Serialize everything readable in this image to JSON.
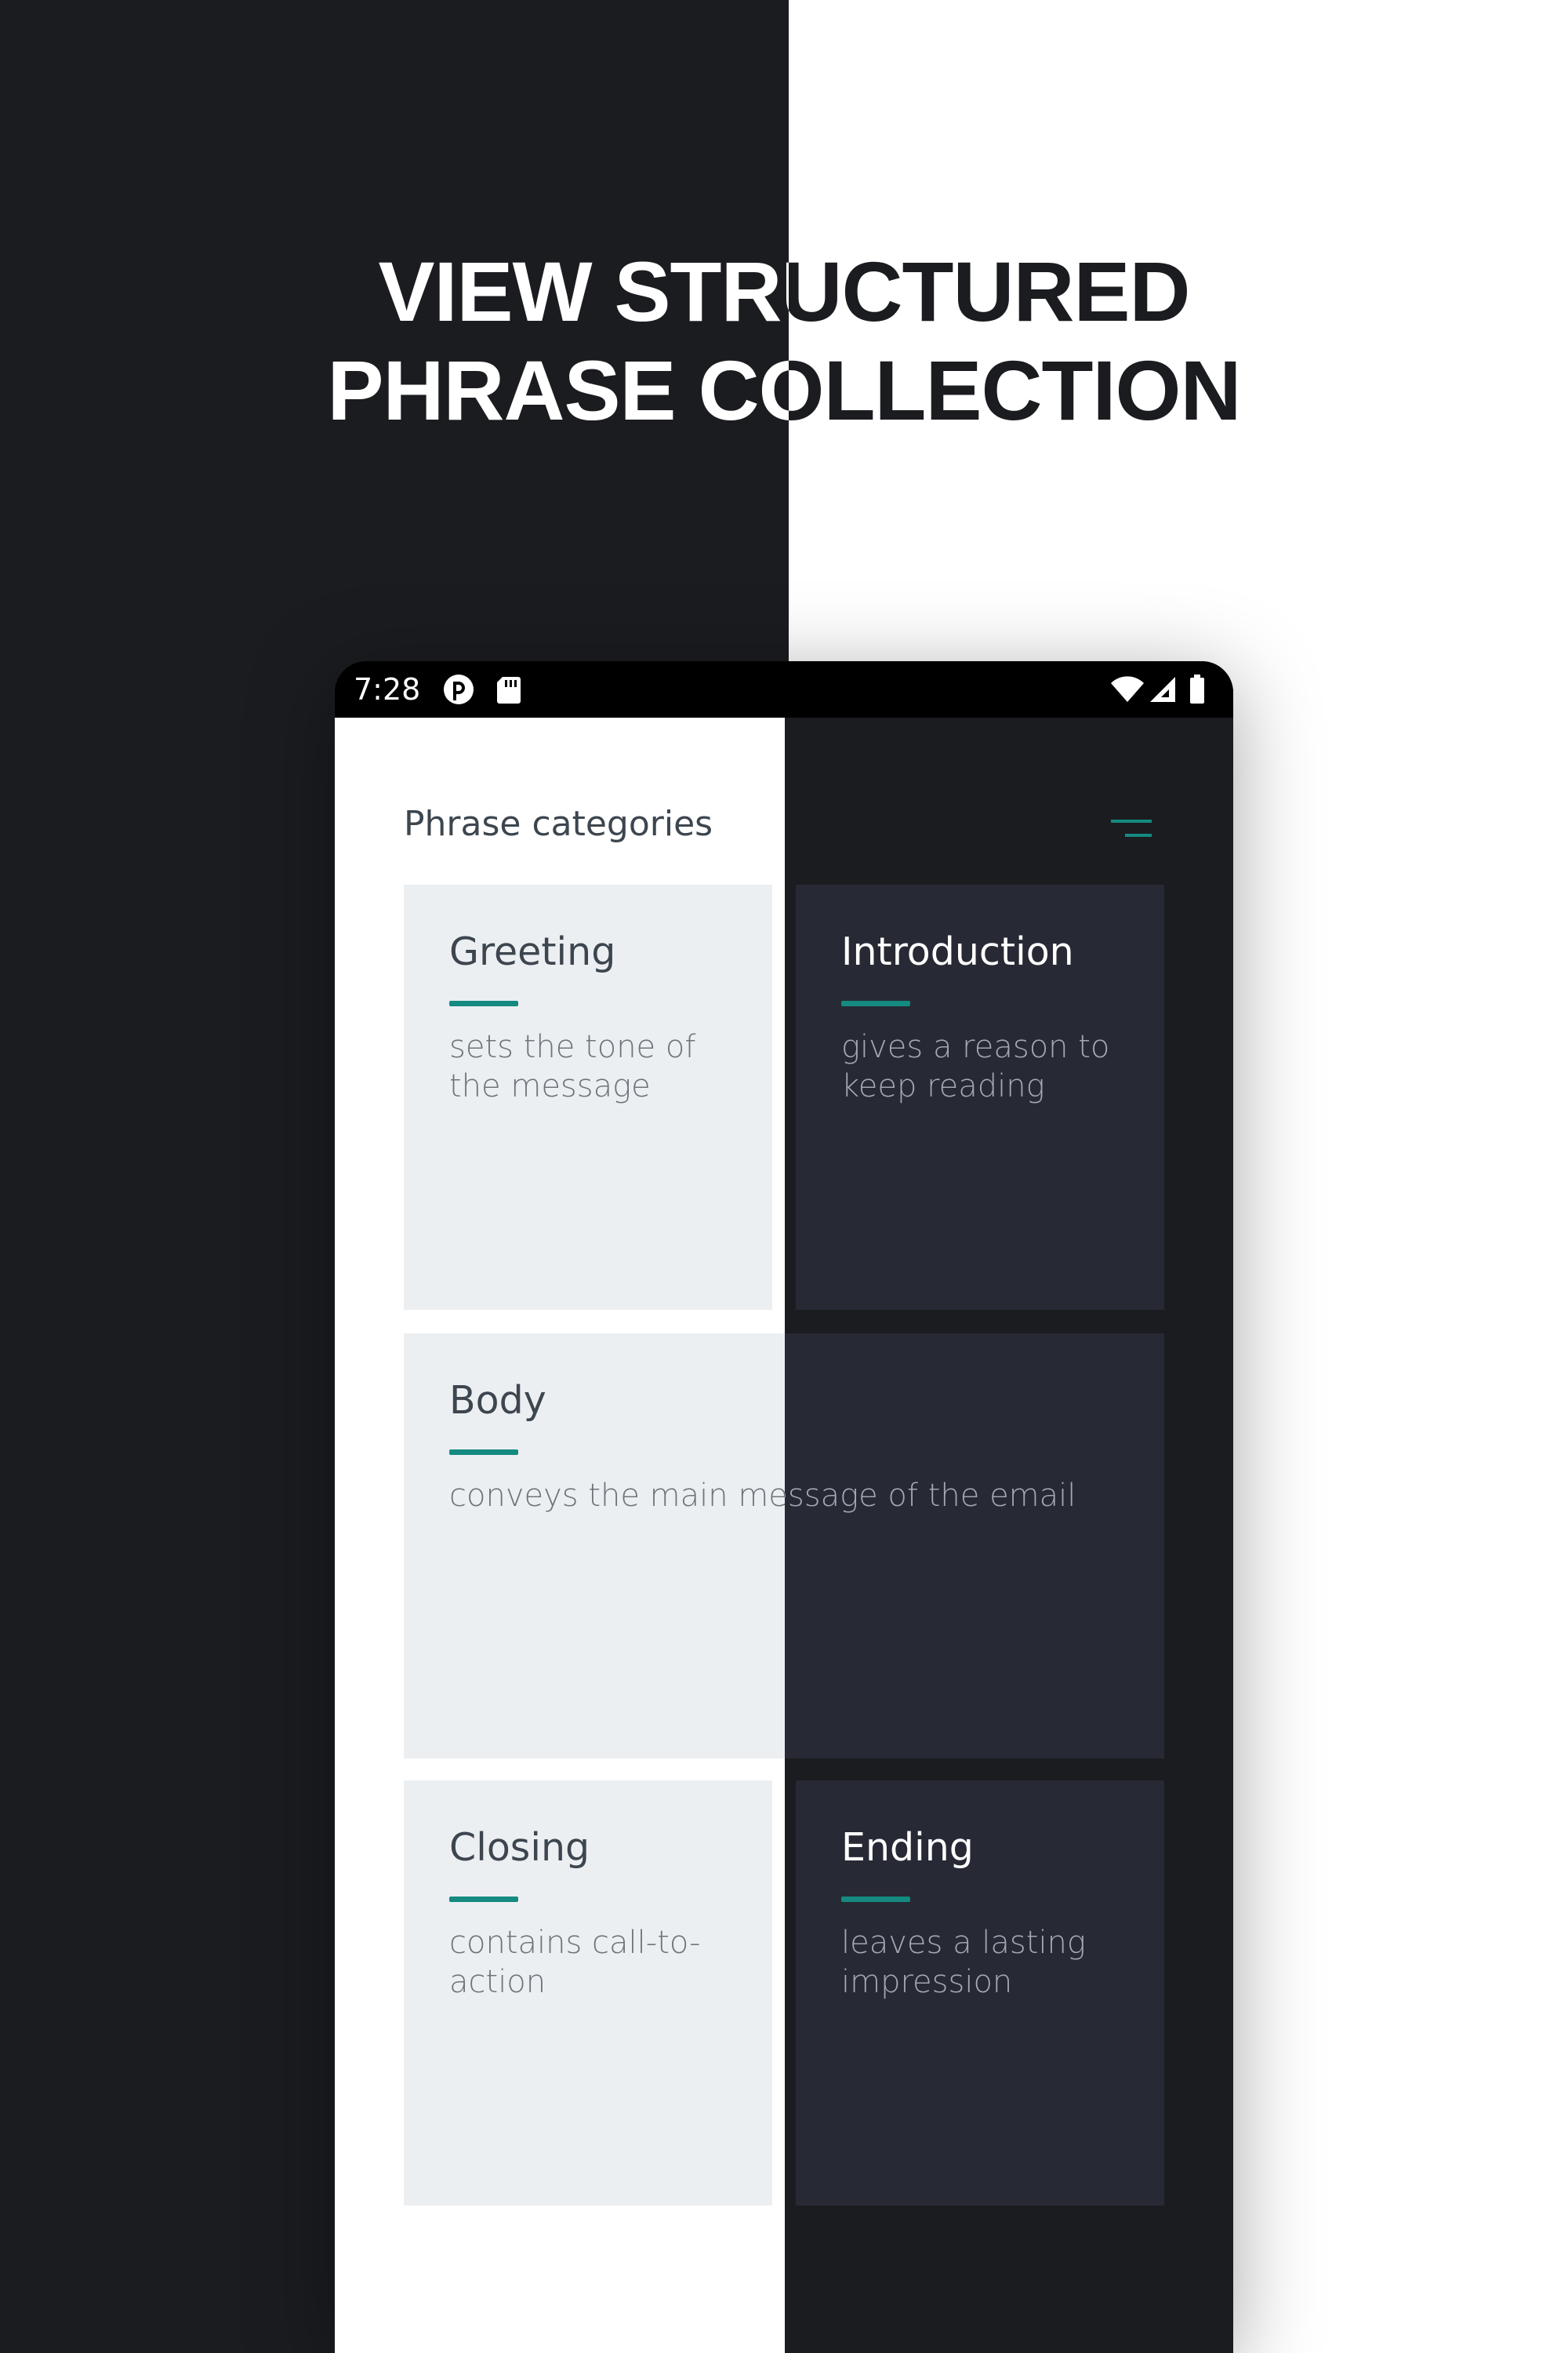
{
  "headline": {
    "line1": "VIEW STRUCTURED",
    "line2": "PHRASE COLLECTION"
  },
  "status_bar": {
    "time": "7:28",
    "icons": [
      "app-notification-icon",
      "sd-card-icon",
      "wifi-icon",
      "cellular-signal-icon",
      "battery-icon"
    ]
  },
  "app": {
    "title": "Phrase categories",
    "menu_icon": "menu-icon",
    "accent_color": "#148a80"
  },
  "cards": [
    {
      "title": "Greeting",
      "description": "sets the tone of the message",
      "theme": "light"
    },
    {
      "title": "Introduction",
      "description": "gives a reason to keep reading",
      "theme": "dark"
    },
    {
      "title": "Body",
      "description": "conveys the main message of the email",
      "theme": "split"
    },
    {
      "title": "Closing",
      "description": "contains call-to-action",
      "theme": "light"
    },
    {
      "title": "Ending",
      "description": "leaves a lasting impression",
      "theme": "dark"
    }
  ],
  "colors": {
    "dark_background": "#1b1c20",
    "light_background": "#ffffff",
    "light_card": "#eceff2",
    "dark_card": "#272935"
  }
}
